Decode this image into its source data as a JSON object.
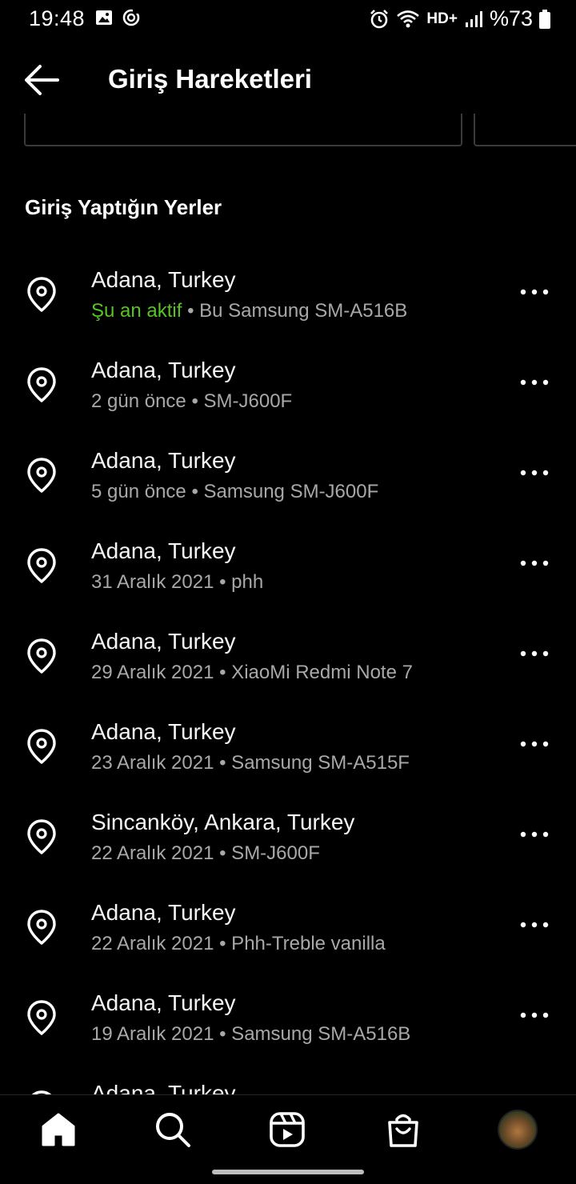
{
  "status_bar": {
    "time": "19:48",
    "network": "HD+",
    "battery": "%73",
    "icons": [
      "image-icon",
      "sync-icon",
      "alarm-icon",
      "wifi-icon",
      "signal-icon",
      "battery-icon"
    ]
  },
  "header": {
    "title": "Giriş Hareketleri",
    "back_icon": "arrow-left-icon"
  },
  "section": {
    "title": "Giriş Yaptığın Yerler"
  },
  "login_activity": [
    {
      "location": "Adana, Turkey",
      "status": "Şu an aktif",
      "detail": "• Bu Samsung SM-A516B"
    },
    {
      "location": "Adana, Turkey",
      "status": "",
      "detail": "2 gün önce • SM-J600F"
    },
    {
      "location": "Adana, Turkey",
      "status": "",
      "detail": "5 gün önce • Samsung SM-J600F"
    },
    {
      "location": "Adana, Turkey",
      "status": "",
      "detail": "31 Aralık 2021 • phh"
    },
    {
      "location": "Adana, Turkey",
      "status": "",
      "detail": "29 Aralık 2021 • XiaoMi Redmi Note 7"
    },
    {
      "location": "Adana, Turkey",
      "status": "",
      "detail": "23 Aralık 2021 • Samsung SM-A515F"
    },
    {
      "location": "Sincanköy, Ankara, Turkey",
      "status": "",
      "detail": "22 Aralık 2021 • SM-J600F"
    },
    {
      "location": "Adana, Turkey",
      "status": "",
      "detail": "22 Aralık 2021 • Phh-Treble vanilla"
    },
    {
      "location": "Adana, Turkey",
      "status": "",
      "detail": "19 Aralık 2021 • Samsung SM-A516B"
    },
    {
      "location": "Adana, Turkey",
      "status": "",
      "detail": ""
    }
  ],
  "colors": {
    "background": "#000000",
    "active_status": "#58c322",
    "secondary_text": "#a8a8a8"
  },
  "bottom_nav": [
    "home-icon",
    "search-icon",
    "reels-icon",
    "shop-icon",
    "profile-avatar"
  ]
}
